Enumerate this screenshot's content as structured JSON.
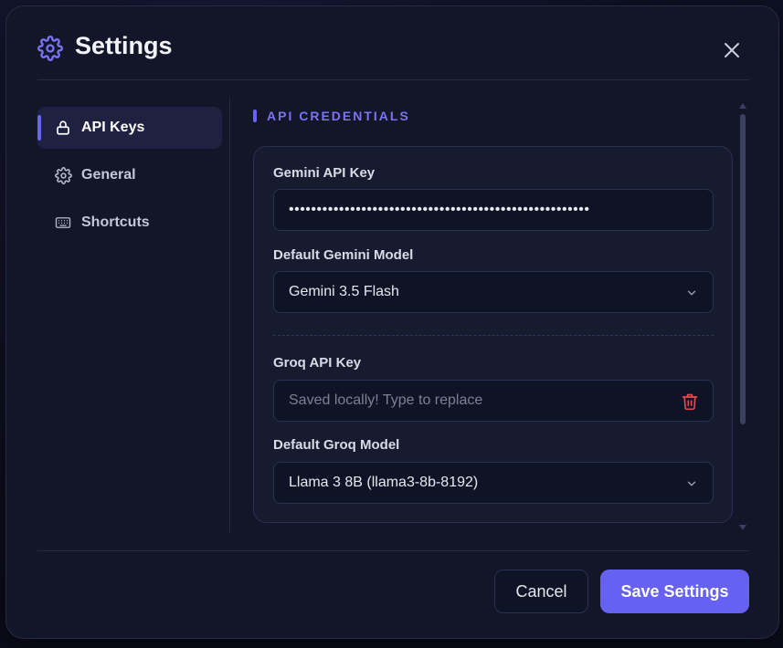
{
  "dialog": {
    "title": "Settings",
    "icon": "gear-icon",
    "close_icon": "close-icon"
  },
  "sidebar": {
    "items": [
      {
        "label": "API Keys",
        "icon": "lock-icon",
        "active": true
      },
      {
        "label": "General",
        "icon": "gear-icon",
        "active": false
      },
      {
        "label": "Shortcuts",
        "icon": "keyboard-icon",
        "active": false
      }
    ]
  },
  "section": {
    "title": "API CREDENTIALS"
  },
  "gemini": {
    "key_label": "Gemini API Key",
    "key_value": "••••••••••••••••••••••••••••••••••••••••••••••••••••••",
    "model_label": "Default Gemini Model",
    "model_value": "Gemini 3.5 Flash"
  },
  "groq": {
    "key_label": "Groq API Key",
    "key_placeholder": "Saved locally! Type to replace",
    "model_label": "Default Groq Model",
    "model_value": "Llama 3 8B (llama3-8b-8192)"
  },
  "footer": {
    "cancel_label": "Cancel",
    "save_label": "Save Settings"
  },
  "colors": {
    "accent": "#6661f0",
    "background": "#121628",
    "danger": "#e5484d"
  }
}
